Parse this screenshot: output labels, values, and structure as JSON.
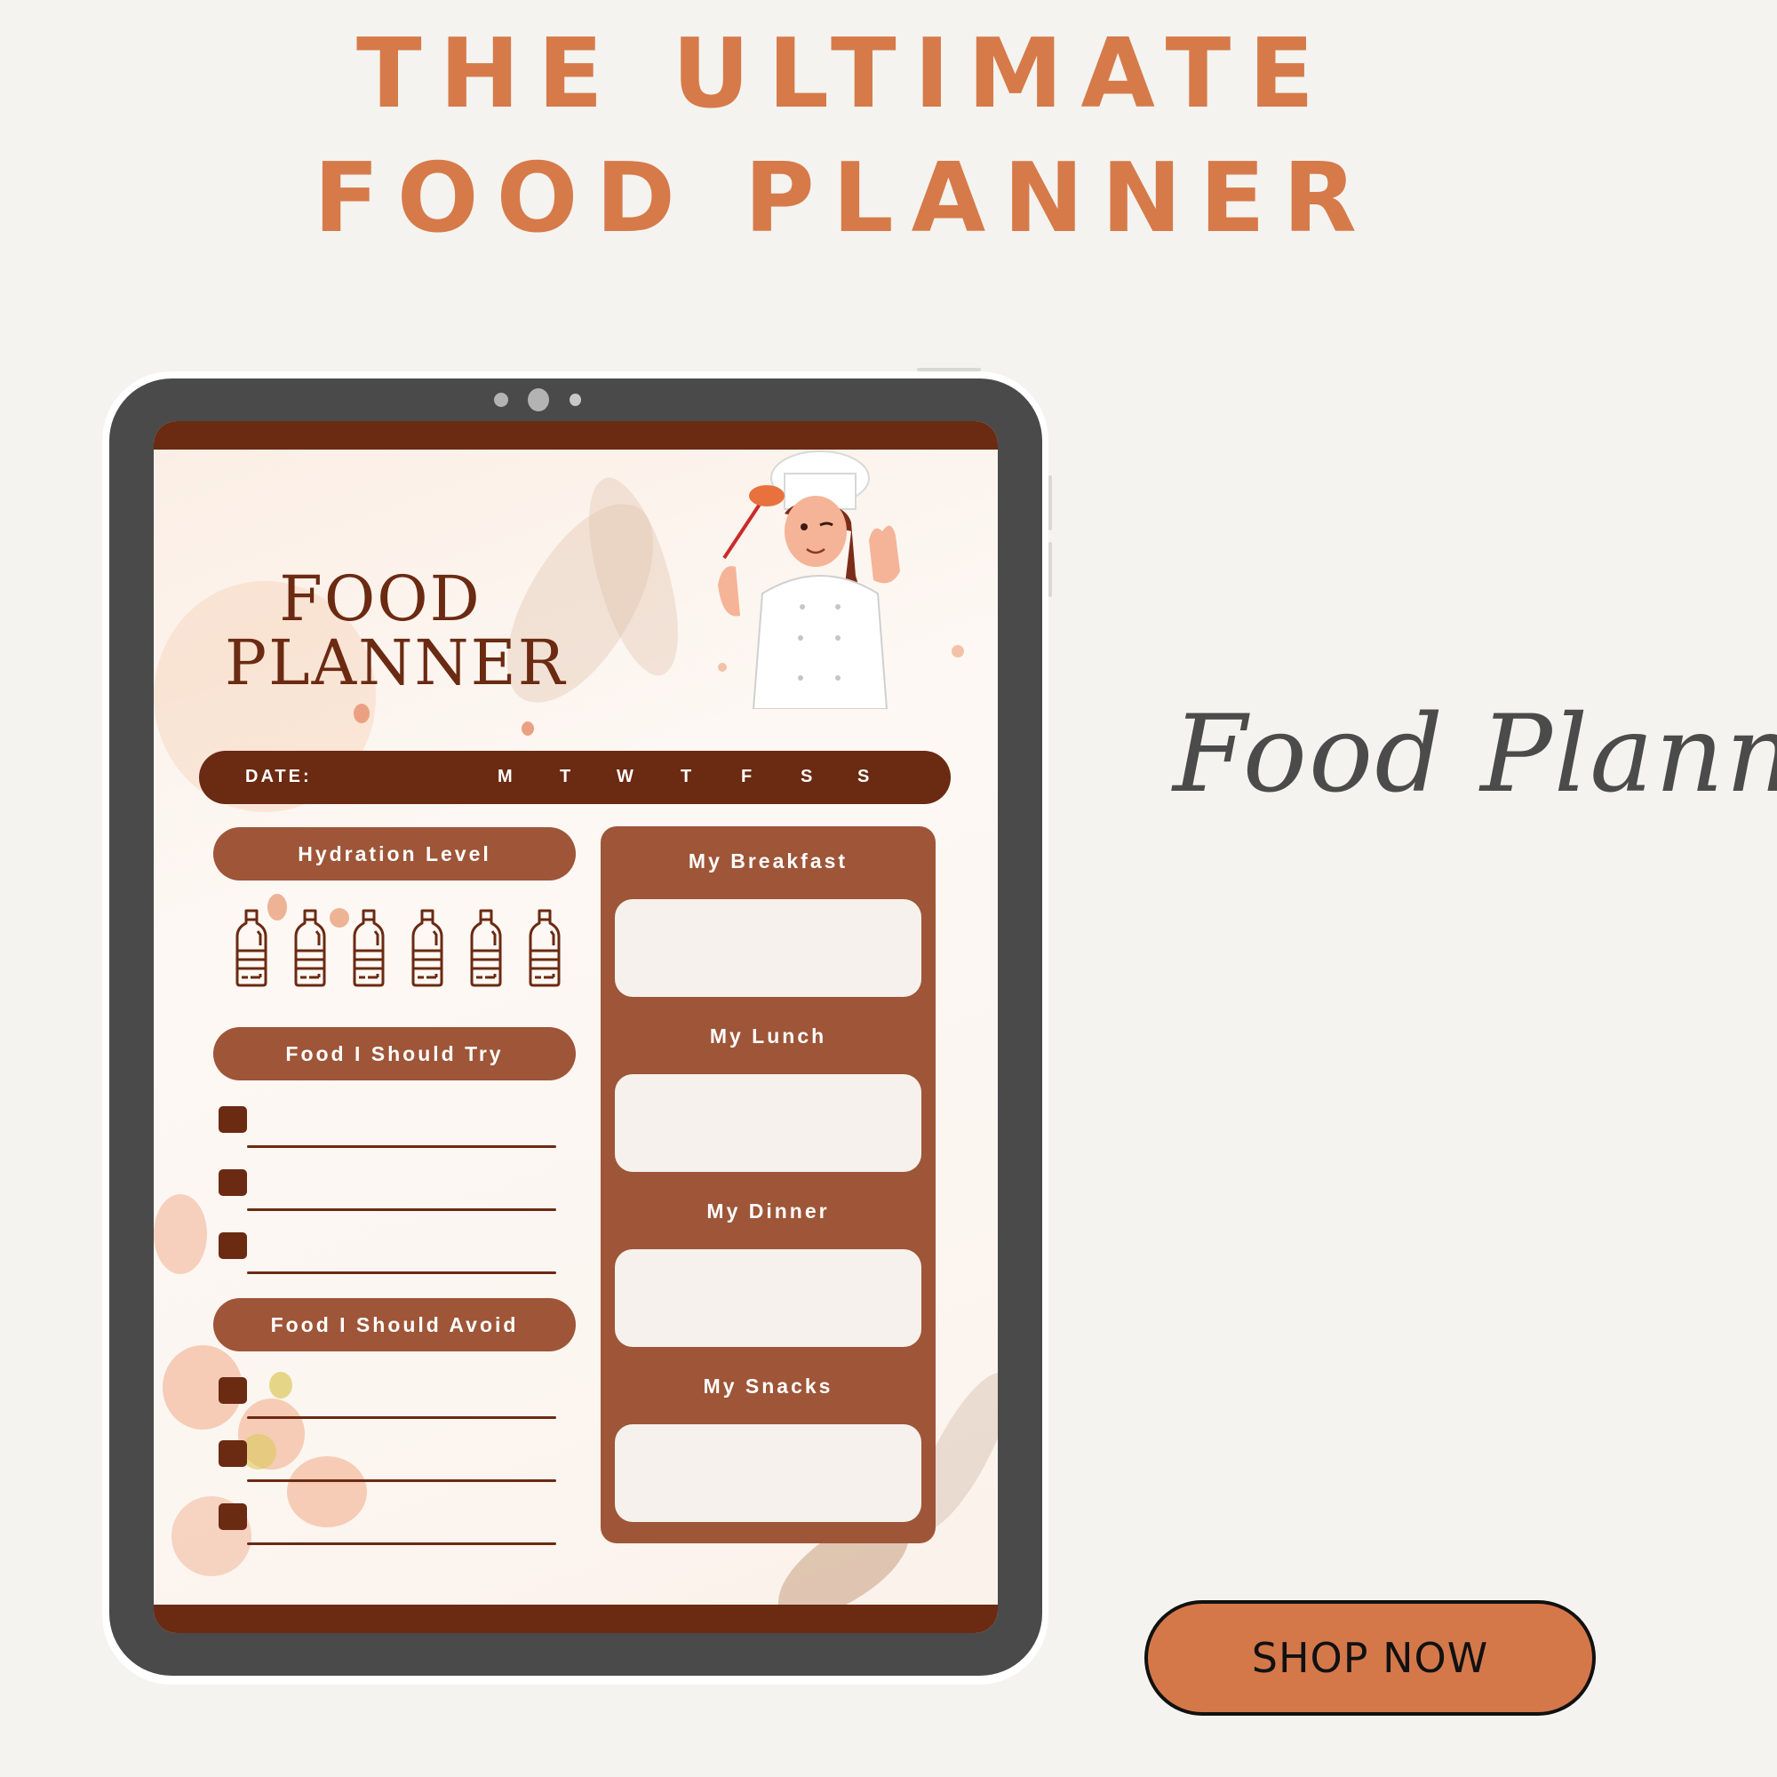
{
  "headline": {
    "line1": "THE ULTIMATE",
    "line2": "FOOD PLANNER"
  },
  "planner": {
    "title_line1": "FOOD",
    "title_line2": "PLANNER",
    "date_label": "DATE:",
    "days": [
      "M",
      "T",
      "W",
      "T",
      "F",
      "S",
      "S"
    ],
    "hydration": {
      "label": "Hydration Level",
      "bottle_count": 6,
      "bottle_icon": "water-bottle-icon"
    },
    "try_section": {
      "label": "Food I Should Try",
      "items": [
        "",
        "",
        ""
      ]
    },
    "avoid_section": {
      "label": "Food I Should Avoid",
      "items": [
        "",
        "",
        ""
      ]
    },
    "meals": [
      {
        "label": "My Breakfast",
        "value": ""
      },
      {
        "label": "My Lunch",
        "value": ""
      },
      {
        "label": "My Dinner",
        "value": ""
      },
      {
        "label": "My Snacks",
        "value": ""
      }
    ],
    "illustration": "chef-woman-illustration"
  },
  "script_title": "Food Planner",
  "cta": {
    "label": "SHOP NOW"
  },
  "colors": {
    "background": "#f4f3ef",
    "accent_orange": "#d67a4a",
    "dark_brown": "#6b2a12",
    "medium_brown": "#9e5538",
    "tablet_frame": "#4a4a4a",
    "box_fill": "#f6f1ec",
    "script_gray": "#4b4b4b"
  }
}
